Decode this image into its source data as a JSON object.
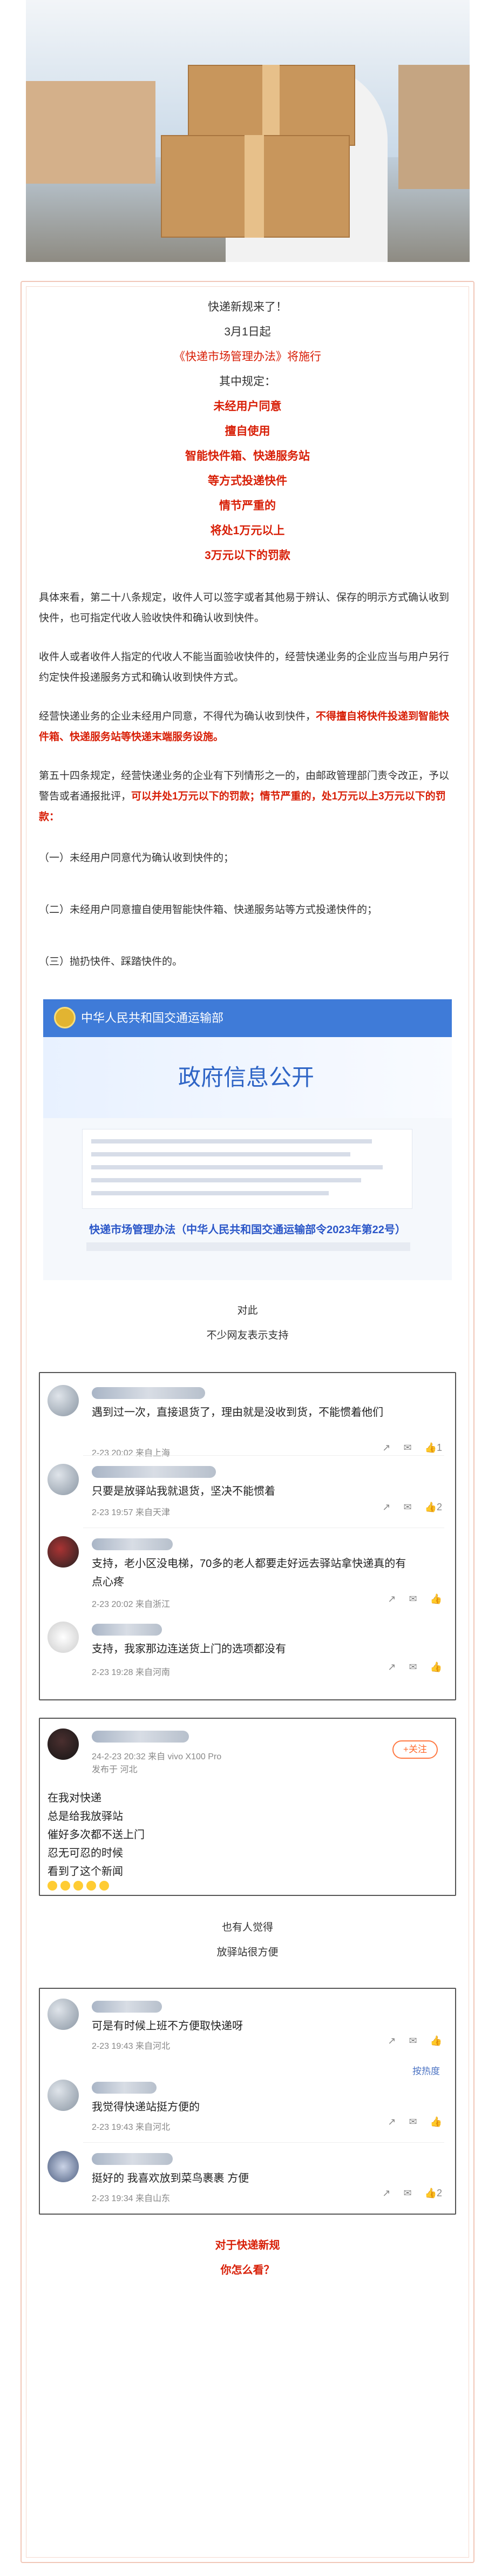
{
  "intro": {
    "line1": "快递新规来了！",
    "line2": "3月1日起",
    "line3": "《快递市场管理办法》将施行",
    "line4": "其中规定：",
    "emph1": "未经用户同意",
    "emph2": "擅自使用",
    "emph3": "智能快件箱、快递服务站",
    "emph4": "等方式投递快件",
    "emph5": "情节严重的",
    "emph6": "将处1万元以上",
    "emph7": "3万元以下的罚款"
  },
  "body": {
    "p1": "具体来看，第二十八条规定，收件人可以签字或者其他易于辨认、保存的明示方式确认收到快件，也可指定代收人验收快件和确认收到快件。",
    "p2": "收件人或者收件人指定的代收人不能当面验收快件的，经营快递业务的企业应当与用户另行约定快件投递服务方式和确认收到快件方式。",
    "p3_a": "经营快递业务的企业未经用户同意，不得代为确认收到快件，",
    "p3_b": "不得擅自将快件投递到智能快件箱、快递服务站等快递末端服务设施。",
    "p4_a": "第五十四条规定，经营快递业务的企业有下列情形之一的，由邮政管理部门责令改正，予以警告或者通报批评，",
    "p4_b": "可以并处1万元以下的罚款；情节严重的，处1万元以上3万元以下的罚款：",
    "item1": "（一）未经用户同意代为确认收到快件的；",
    "item2": "（二）未经用户同意擅自使用智能快件箱、快递服务站等方式投递快件的；",
    "item3": "（三）抛扔快件、踩踏快件的。"
  },
  "gov": {
    "ministry": "中华人民共和国交通运输部",
    "banner": "政府信息公开",
    "doc_title": "快递市场管理办法（中华人民共和国交通运输部令2023年第22号）"
  },
  "mid": {
    "t1": "对此",
    "t2": "不少网友表示支持",
    "t3": "也有人觉得",
    "t4": "放驿站很方便"
  },
  "comments1": [
    {
      "text": "遇到过一次，直接退货了，理由就是没收到货，不能惯着他们",
      "meta": "2-23 20:02  来自上海",
      "likes": "1"
    },
    {
      "text": "只要是放驿站我就退货，坚决不能惯着",
      "meta": "2-23 19:57  来自天津",
      "likes": "2"
    },
    {
      "text": "支持，老小区没电梯，70多的老人都要走好远去驿站拿快递真的有点心疼",
      "meta": "2-23 20:02  来自浙江",
      "likes": ""
    },
    {
      "text": "支持，我家那边连送货上门的选项都没有",
      "meta": "2-23 19:28  来自河南",
      "likes": ""
    }
  ],
  "weibo": {
    "time": "24-2-23 20:32  来自 vivo X100 Pro",
    "loc": "发布于 河北",
    "follow": "+关注",
    "lines": [
      "在我对快递",
      "总是给我放驿站",
      "催好多次都不送上门",
      "忍无可忍的时候",
      "看到了这个新闻"
    ]
  },
  "comments2": [
    {
      "text": "可是有时候上班不方便取快递呀",
      "meta": "2-23 19:43  来自河北"
    },
    {
      "text": "我觉得快递站挺方便的",
      "meta": "2-23 19:43  来自河北"
    },
    {
      "text": "挺好的 我喜欢放到菜鸟裹裹 方便",
      "meta": "2-23 19:34  来自山东",
      "likes": "2"
    }
  ],
  "fold_label": "按热度",
  "outro": {
    "q1": "对于快递新规",
    "q2": "你怎么看？"
  },
  "colors": {
    "accent_red": "#d81e06",
    "link_blue": "#4d74c3",
    "frame": "#f1c7b8"
  }
}
